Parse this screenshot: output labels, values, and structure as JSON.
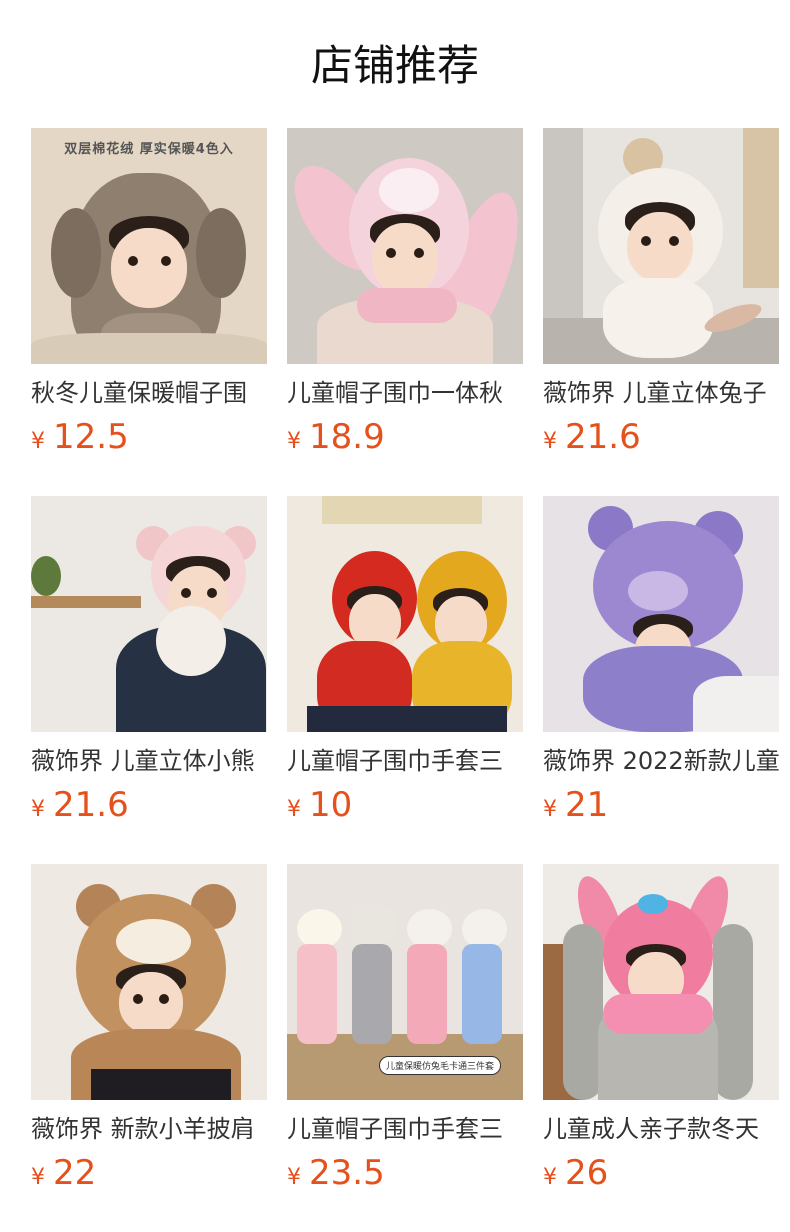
{
  "header": {
    "title": "店铺推荐"
  },
  "currency_symbol": "¥",
  "products": [
    {
      "name": "秋冬儿童保暖帽子围",
      "price": "12.5",
      "image_text": "双层棉花绒  厚实保暖4色入"
    },
    {
      "name": "儿童帽子围巾一体秋",
      "price": "18.9"
    },
    {
      "name": "薇饰界 儿童立体兔子",
      "price": "21.6"
    },
    {
      "name": "薇饰界 儿童立体小熊",
      "price": "21.6"
    },
    {
      "name": "儿童帽子围巾手套三",
      "price": "10"
    },
    {
      "name": "薇饰界 2022新款儿童",
      "price": "21"
    },
    {
      "name": "薇饰界 新款小羊披肩",
      "price": "22"
    },
    {
      "name": "儿童帽子围巾手套三",
      "price": "23.5",
      "image_text": "儿童保暖仿兔毛卡通三件套"
    },
    {
      "name": "儿童成人亲子款冬天",
      "price": "26"
    }
  ],
  "colors": {
    "price": "#e4511c",
    "title": "#111111",
    "name": "#333333"
  }
}
